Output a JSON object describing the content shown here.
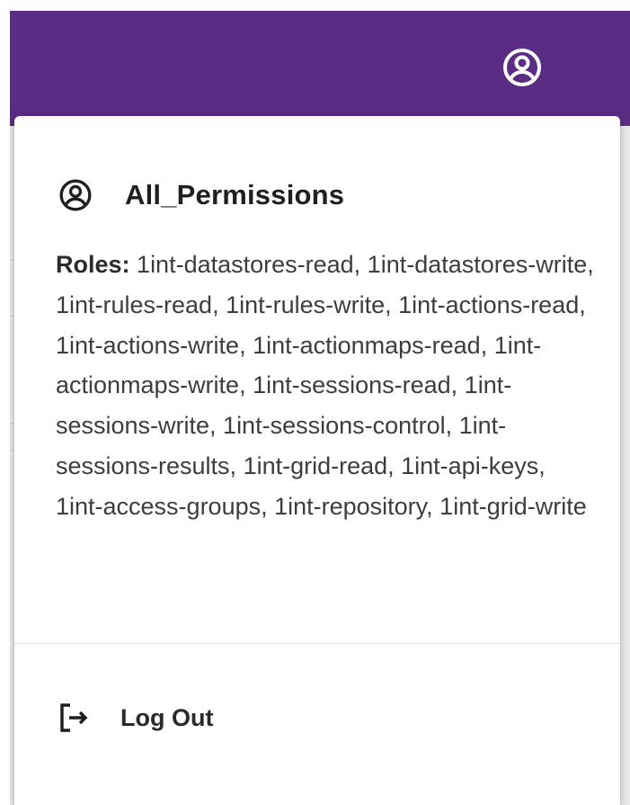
{
  "app_bar": {
    "background_color": "#5b2c83",
    "account_icon": "account-circle-icon"
  },
  "user_menu": {
    "user_icon": "account-circle-icon",
    "username": "All_Permissions",
    "roles_label": "Roles:",
    "roles_value": "1int-datastores-read, 1int-datastores-write, 1int-rules-read, 1int-rules-write, 1int-actions-read, 1int-actions-write, 1int-actionmaps-read, 1int-actionmaps-write, 1int-sessions-read, 1int-sessions-write, 1int-sessions-control, 1int-sessions-results, 1int-grid-read, 1int-api-keys, 1int-access-groups, 1int-repository, 1int-grid-write",
    "logout_icon": "logout-icon",
    "logout_label": "Log Out"
  }
}
